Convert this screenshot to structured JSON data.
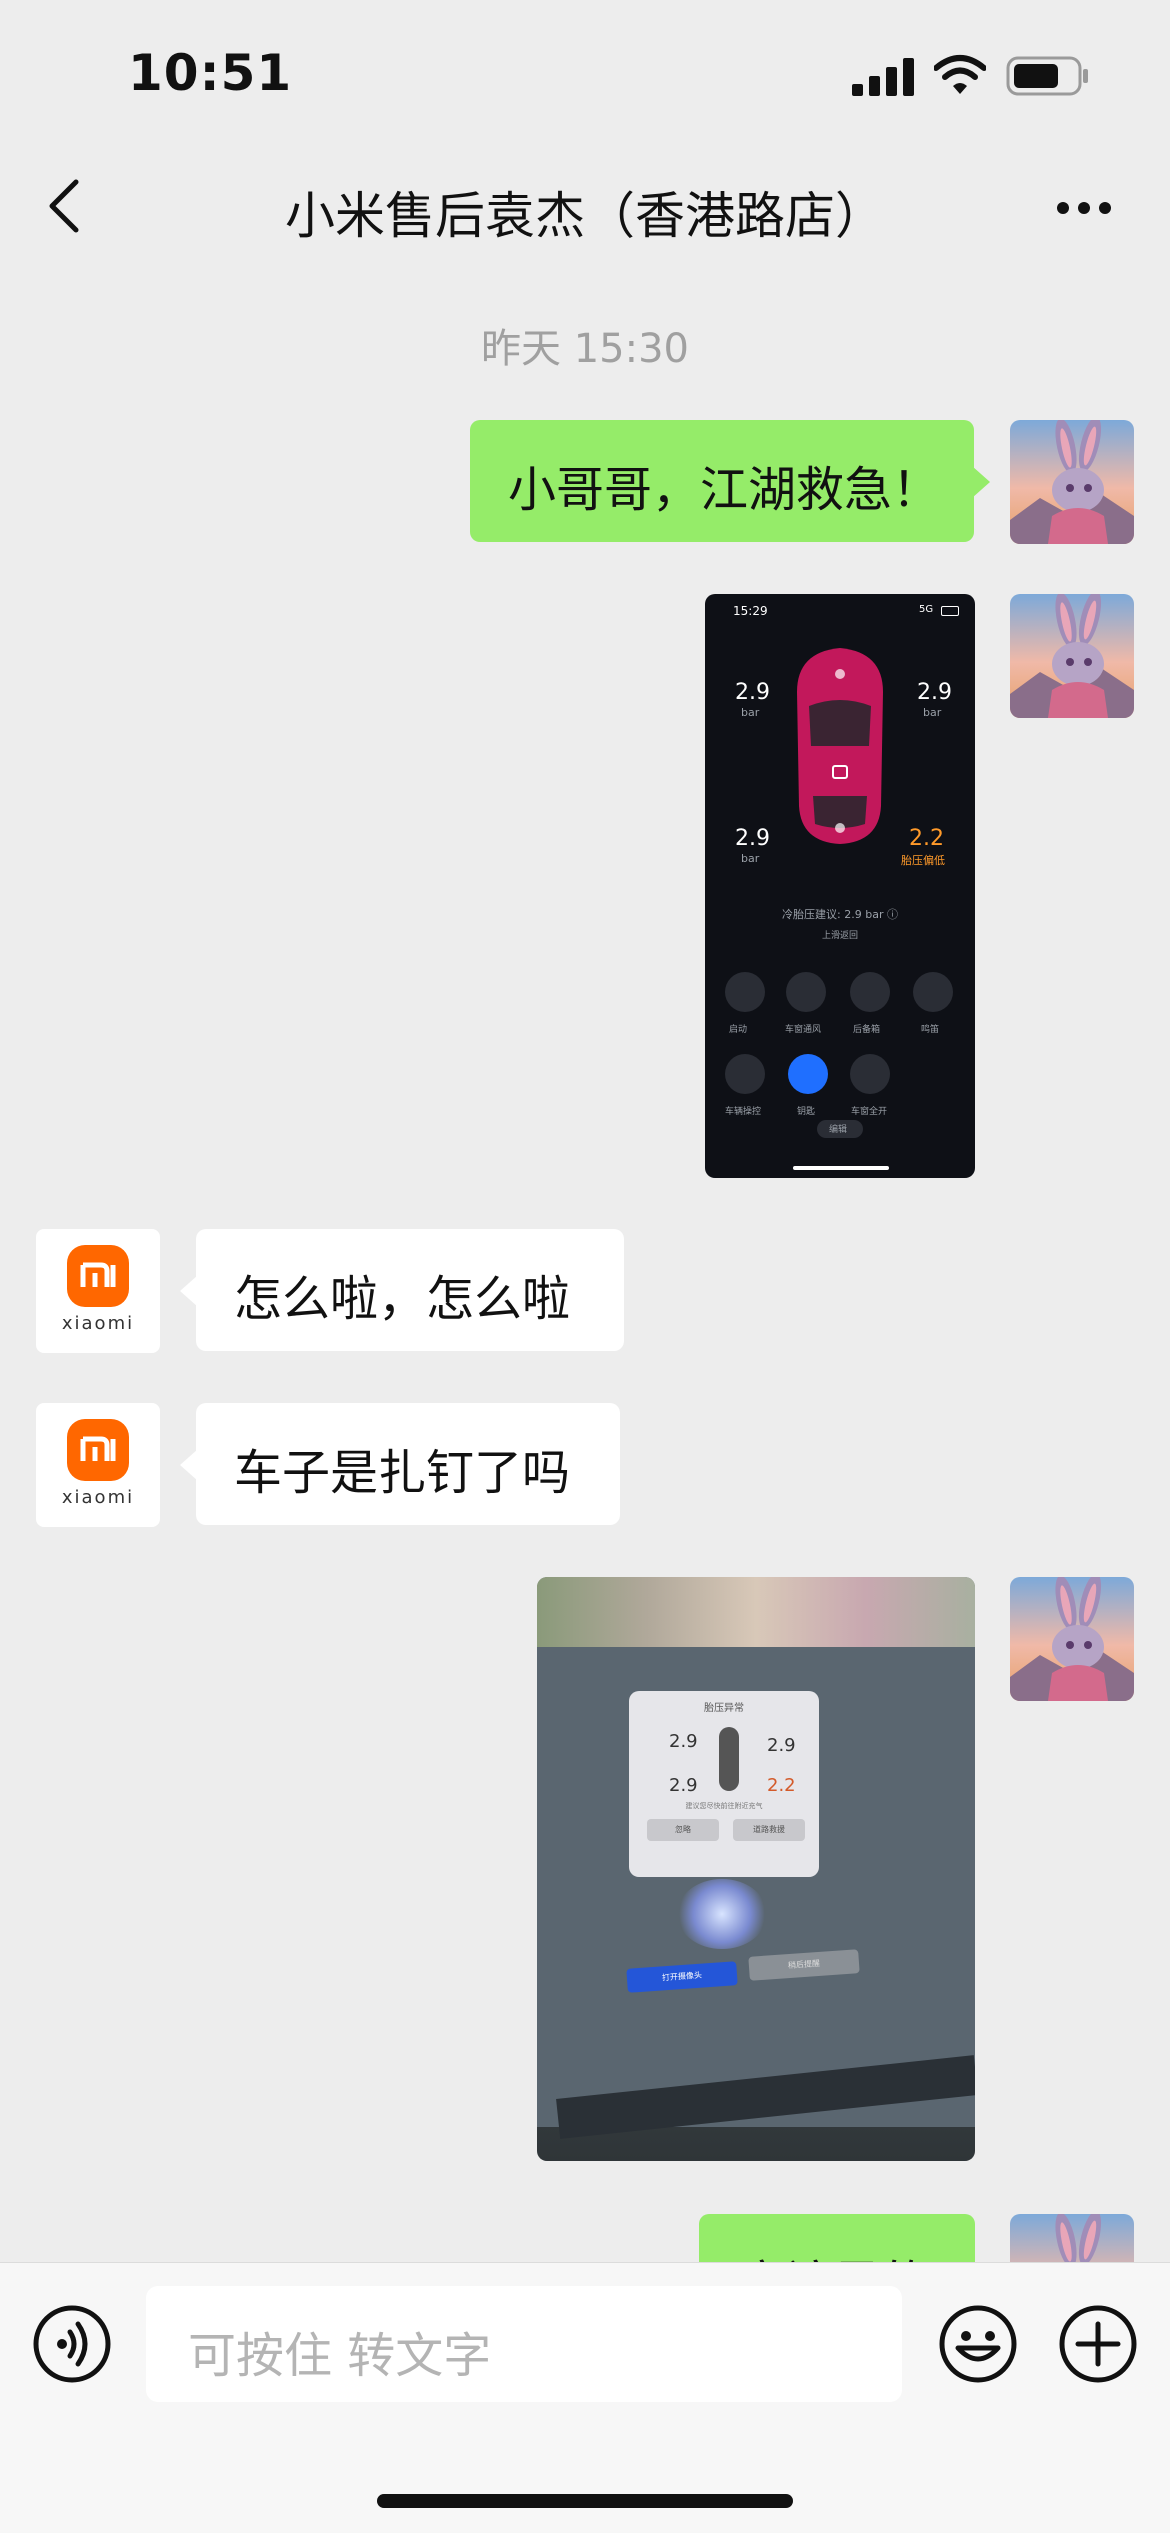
{
  "status_bar": {
    "time": "10:51"
  },
  "nav": {
    "title": "小米售后袁杰（香港路店）"
  },
  "chat": {
    "timestamp": "昨天 15:30",
    "messages": [
      {
        "sender": "me",
        "type": "text",
        "text": "小哥哥，江湖救急！"
      },
      {
        "sender": "me",
        "type": "image",
        "desc": "app-screenshot"
      },
      {
        "sender": "other",
        "type": "text",
        "text": "怎么啦，怎么啦"
      },
      {
        "sender": "other",
        "type": "text",
        "text": "车子是扎钉了吗"
      },
      {
        "sender": "me",
        "type": "image",
        "desc": "car-screen-photo"
      },
      {
        "sender": "me",
        "type": "text",
        "text": "应该是的"
      }
    ],
    "contact_avatar_label": "xiaomi"
  },
  "phone_shot": {
    "time": "15:29",
    "signal": "5G",
    "tire_fl": "2.9",
    "tire_fr": "2.9",
    "tire_rl": "2.9",
    "tire_rr": "2.2",
    "unit": "bar",
    "warn": "胎压偏低",
    "advice": "冷胎压建议: 2.9 bar ⓘ",
    "sub": "上滑返回",
    "controls_row1": [
      "启动",
      "车窗通风",
      "后备箱",
      "鸣笛"
    ],
    "controls_row2": [
      "车辆操控",
      "钥匙",
      "车窗全开"
    ],
    "edit": "编辑"
  },
  "car_screen": {
    "title": "胎压异常",
    "fl": "2.9",
    "fr": "2.9",
    "rl": "2.9",
    "rr": "2.2",
    "hint": "建议您尽快前往附近充气",
    "btn_left": "忽略",
    "btn_right": "道路救援",
    "btn_blue": "打开摄像头",
    "btn_gray": "稍后提醒"
  },
  "input": {
    "placeholder": "可按住 转文字"
  },
  "colors": {
    "bubble_green": "#95ec69",
    "background": "#ededed",
    "xiaomi_orange": "#ff6700"
  }
}
